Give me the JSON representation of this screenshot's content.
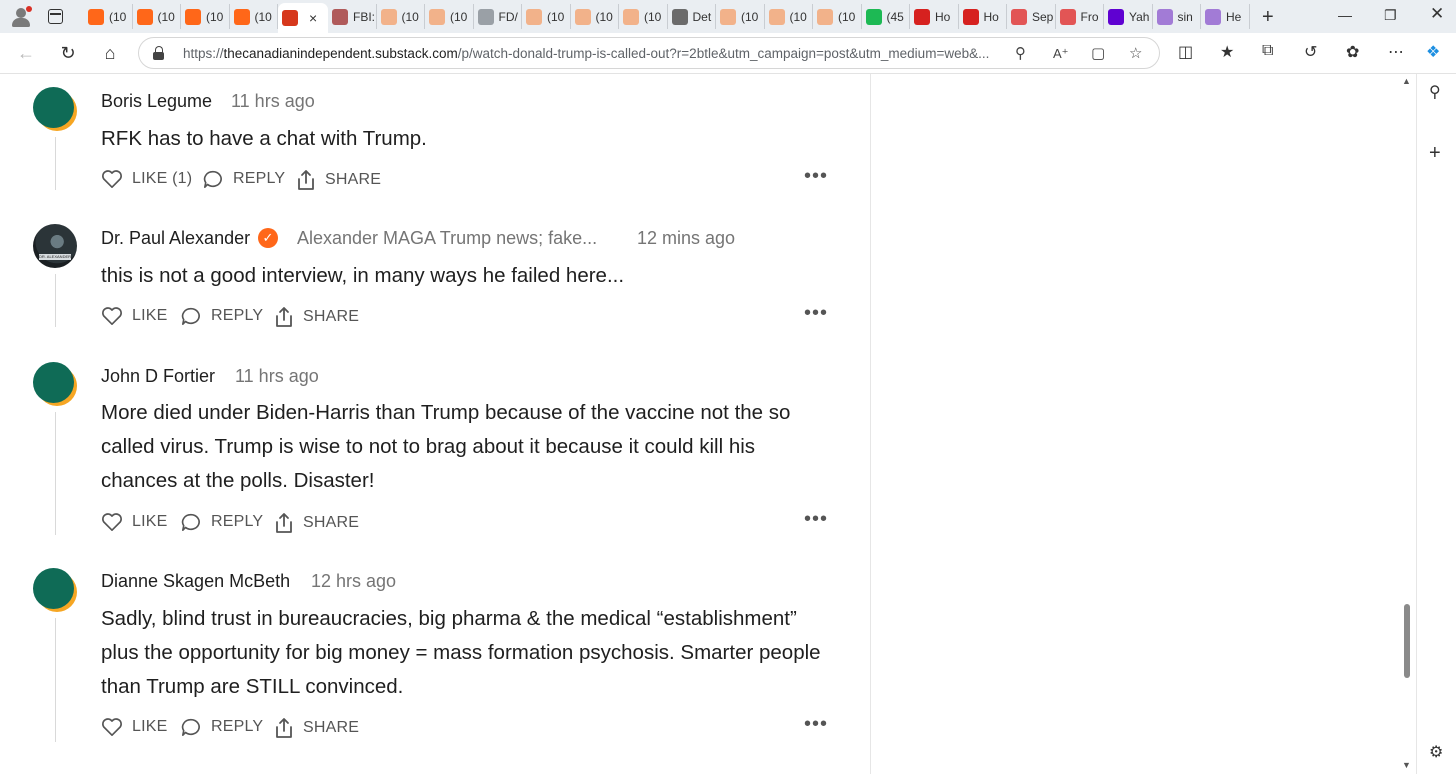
{
  "browser": {
    "tabs": [
      {
        "label": "(10",
        "color": "#ff6719"
      },
      {
        "label": "(10",
        "color": "#ff6719"
      },
      {
        "label": "(10",
        "color": "#ff6719"
      },
      {
        "label": "(10",
        "color": "#ff6719"
      },
      {
        "label": "",
        "color": "#d6381c",
        "active": true,
        "close": "×"
      },
      {
        "label": "FBI:",
        "color": "#b05a5a"
      },
      {
        "label": "(10",
        "color": "#f2b28a"
      },
      {
        "label": "(10",
        "color": "#f2b28a"
      },
      {
        "label": "FD/",
        "color": "#9aa0a6"
      },
      {
        "label": "(10",
        "color": "#f2b28a"
      },
      {
        "label": "(10",
        "color": "#f2b28a"
      },
      {
        "label": "(10",
        "color": "#f2b28a"
      },
      {
        "label": "Det",
        "color": "#6b6b6b"
      },
      {
        "label": "(10",
        "color": "#f2b28a"
      },
      {
        "label": "(10",
        "color": "#f2b28a"
      },
      {
        "label": "(10",
        "color": "#f2b28a"
      },
      {
        "label": "(45",
        "color": "#1db954"
      },
      {
        "label": "Ho",
        "color": "#d6211f"
      },
      {
        "label": "Ho",
        "color": "#d6211f"
      },
      {
        "label": "Sep",
        "color": "#e25555"
      },
      {
        "label": "Fro",
        "color": "#e25555"
      },
      {
        "label": "Yah",
        "color": "#5f01d1"
      },
      {
        "label": "sin",
        "color": "#a27bd6"
      },
      {
        "label": "He",
        "color": "#a27bd6"
      }
    ],
    "new_tab": "+",
    "url_prefix": "https://",
    "url_host": "thecanadianindependent.substack.com",
    "url_path": "/p/watch-donald-trump-is-called-out?r=2btle&utm_campaign=post&utm_medium=web&..."
  },
  "comments": [
    {
      "author": "Boris Legume",
      "meta": "11 hrs ago",
      "body": "RFK has to have a chat with Trump.",
      "like": "LIKE (1)",
      "reply": "REPLY",
      "share": "SHARE",
      "more": "•••"
    },
    {
      "author": "Dr. Paul Alexander",
      "badge": "✓",
      "meta": "Alexander MAGA Trump news; fake...",
      "time": "12 mins ago",
      "avatar_text": "DR. ALEXANDER",
      "body": "this is not a good interview, in many ways he failed here...",
      "like": "LIKE",
      "reply": "REPLY",
      "share": "SHARE",
      "more": "•••"
    },
    {
      "author": "John D Fortier",
      "meta": "11 hrs ago",
      "body": "More died under Biden-Harris than Trump because of the vaccine not the so called virus. Trump is wise to not to brag about it because it could kill his chances at the polls. Disaster!",
      "like": "LIKE",
      "reply": "REPLY",
      "share": "SHARE",
      "more": "•••"
    },
    {
      "author": "Dianne Skagen McBeth",
      "meta": "12 hrs ago",
      "body": "Sadly, blind trust in bureaucracies, big pharma & the medical “establishment” plus the opportunity for big money = mass formation psychosis. Smarter people than Trump are STILL convinced.",
      "like": "LIKE",
      "reply": "REPLY",
      "share": "SHARE",
      "more": "•••"
    }
  ]
}
